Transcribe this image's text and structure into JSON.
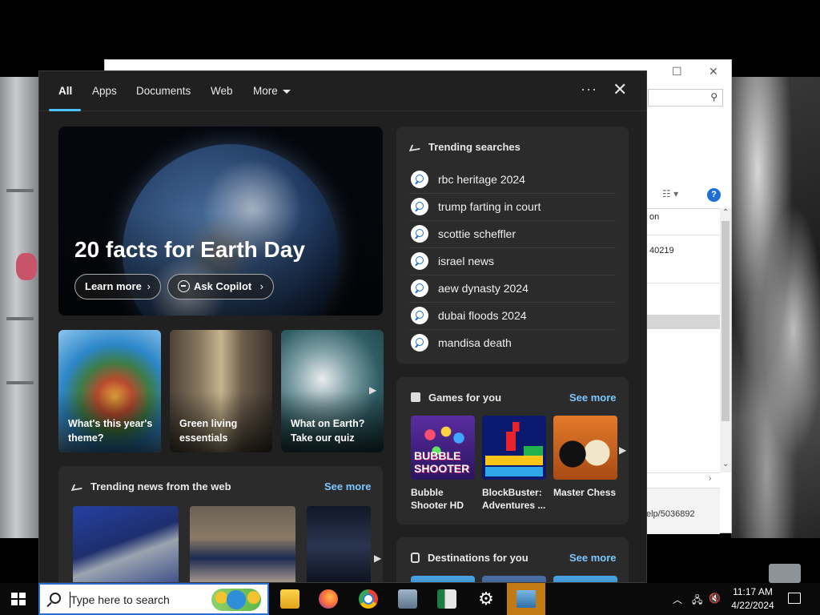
{
  "tabs": [
    {
      "label": "All"
    },
    {
      "label": "Apps"
    },
    {
      "label": "Documents"
    },
    {
      "label": "Web"
    },
    {
      "label": "More"
    }
  ],
  "panel": {
    "more_options": "···",
    "close": "✕"
  },
  "hero": {
    "title": "20 facts for Earth Day",
    "learn_more": "Learn more",
    "ask_copilot": "Ask Copilot"
  },
  "cards": [
    {
      "text": "What's this year's theme?"
    },
    {
      "text": "Green living essentials"
    },
    {
      "text": "What on Earth? Take our quiz"
    }
  ],
  "trending_searches": {
    "title": "Trending searches",
    "items": [
      "rbc heritage 2024",
      "trump farting in court",
      "scottie scheffler",
      "israel news",
      "aew dynasty 2024",
      "dubai floods 2024",
      "mandisa death"
    ]
  },
  "trending_news": {
    "title": "Trending news from the web",
    "see_more": "See more"
  },
  "games": {
    "title": "Games for you",
    "see_more": "See more",
    "items": [
      {
        "name": "Bubble Shooter HD",
        "thumb_text": "BUBBLE SHOOTER"
      },
      {
        "name": "BlockBuster: Adventures ..."
      },
      {
        "name": "Master Chess"
      }
    ]
  },
  "destinations": {
    "title": "Destinations for you",
    "see_more": "See more"
  },
  "taskbar": {
    "search_placeholder": "Type here to search",
    "time": "11:17 AM",
    "date": "4/22/2024"
  },
  "background_window": {
    "cell_1": "on",
    "cell_2": "40219",
    "footer_link": "elp/5036892"
  },
  "colors": {
    "accent": "#4cc2ff",
    "see_more": "#7cc7ff",
    "panel_bg": "#202020",
    "card_bg": "#2b2b2b",
    "active_taskbar": "#c27a12"
  }
}
